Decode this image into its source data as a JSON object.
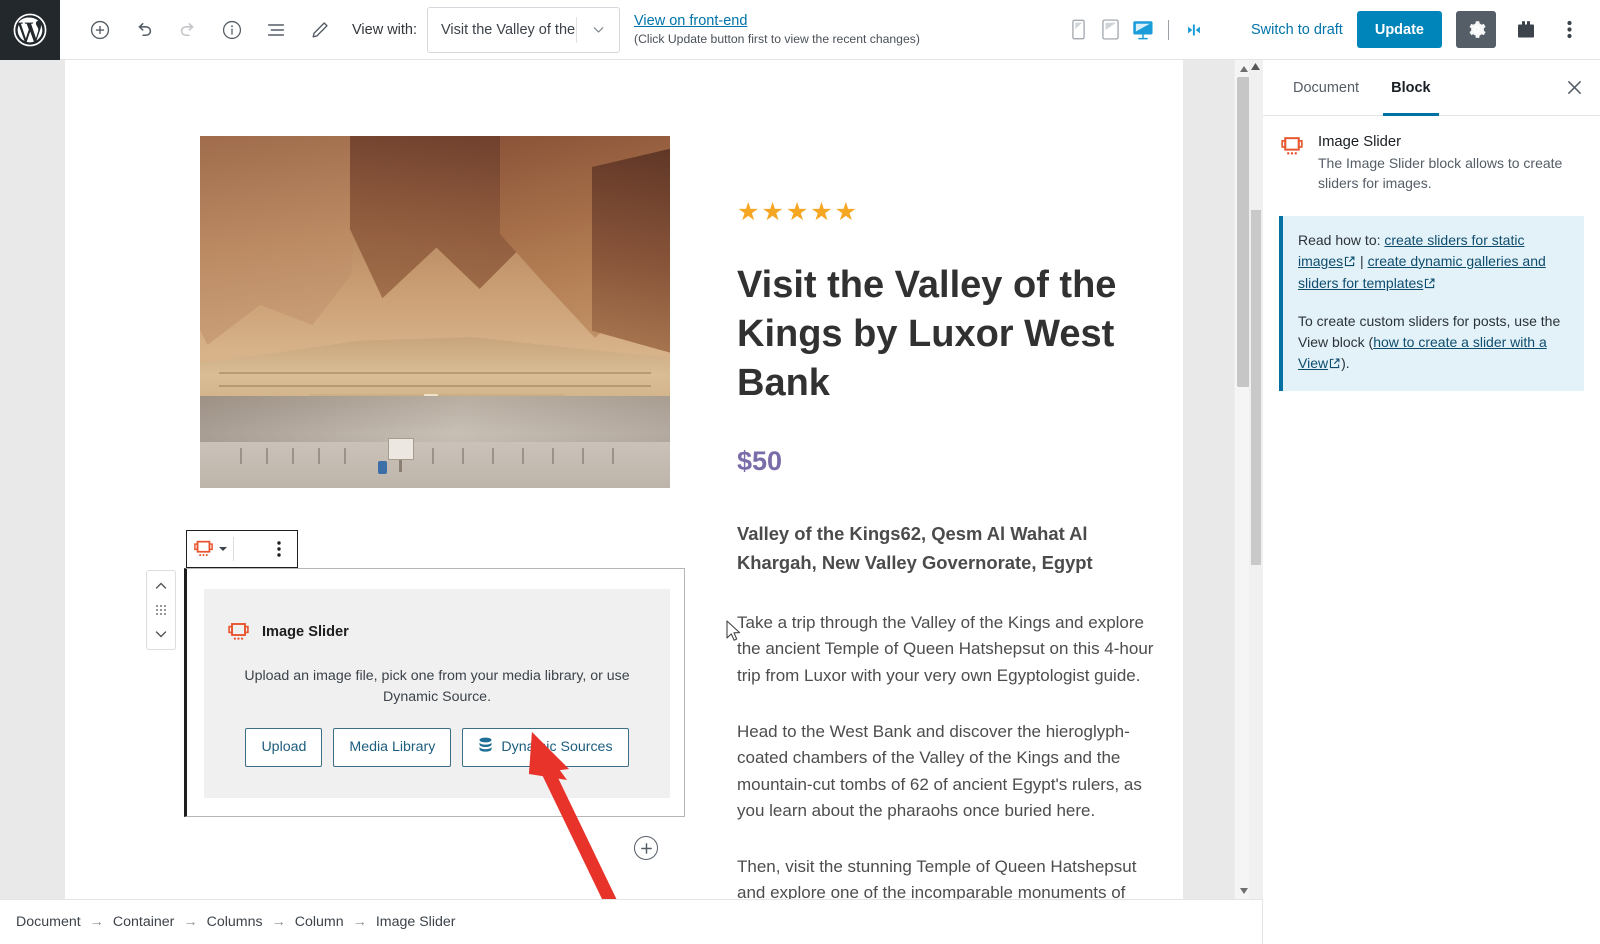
{
  "topbar": {
    "logo_icon": "wordpress-logo-icon",
    "tools": [
      {
        "name": "add-block-button",
        "icon": "plus-circle-icon"
      },
      {
        "name": "undo-button",
        "icon": "undo-arrow-icon"
      },
      {
        "name": "redo-button",
        "icon": "redo-arrow-icon"
      },
      {
        "name": "content-info-button",
        "icon": "info-circle-icon"
      },
      {
        "name": "block-navigation-button",
        "icon": "list-view-icon"
      },
      {
        "name": "edit-mode-button",
        "icon": "pencil-icon"
      }
    ],
    "view_with_label": "View with:",
    "view_with_value": "Visit the Valley of the...",
    "view_with_caret_icon": "chevron-down-icon",
    "frontend_link": "View on front-end",
    "frontend_note": "(Click Update button first to view the recent changes)",
    "devices": [
      {
        "name": "preview-mobile",
        "icon": "mobile-icon",
        "active": false
      },
      {
        "name": "preview-tablet",
        "icon": "tablet-icon",
        "active": false
      },
      {
        "name": "preview-desktop",
        "icon": "desktop-icon",
        "active": true
      },
      {
        "name": "preview-responsive-width",
        "icon": "resize-handles-icon",
        "active": true
      }
    ],
    "switch_to_draft": "Switch to draft",
    "update_label": "Update",
    "settings_icon": "gear-icon",
    "plugin_icon": "toolbox-icon",
    "more_icon": "vertical-dots-icon",
    "accent_blue": "#0085ba",
    "link_blue": "#0073aa"
  },
  "editor": {
    "stars": "★★★★★",
    "star_color": "#f5a623",
    "title": "Visit the Valley of the Kings by Luxor West Bank",
    "price": "$50",
    "price_color": "#7a6ca8",
    "address": "Valley of the Kings62, Qesm Al Wahat Al Khargah, New Valley Governorate, Egypt",
    "paragraphs": [
      "Take a trip through the Valley of the Kings and explore the ancient Temple of Queen Hatshepsut on this 4-hour trip from Luxor with your very own Egyptologist guide.",
      "Head to the West Bank and discover the hieroglyph-coated chambers of the Valley of the Kings and the mountain-cut tombs of 62 of ancient Egypt's rulers, as you learn about the pharaohs once buried here.",
      "Then, visit the stunning Temple of Queen Hatshepsut and explore one of the incomparable monuments of ancient Egypt."
    ],
    "hero_image_alt": "Temple of Queen Hatshepsut at Deir el-Bahari"
  },
  "slider_block": {
    "toolbar": {
      "type_icon": "image-slider-block-icon",
      "type_caret_icon": "chevron-down-icon",
      "more_icon": "vertical-dots-icon"
    },
    "mover": {
      "up_icon": "chevron-up-icon",
      "drag_icon": "drag-handle-icon",
      "down_icon": "chevron-down-icon"
    },
    "icon": "image-slider-block-icon",
    "title": "Image Slider",
    "description": "Upload an image file, pick one from your media library, or use Dynamic Source.",
    "buttons": [
      {
        "name": "upload-button",
        "label": "Upload",
        "icon": null
      },
      {
        "name": "media-library-button",
        "label": "Media Library",
        "icon": null
      },
      {
        "name": "dynamic-sources-button",
        "label": "Dynamic Sources",
        "icon": "database-stack-icon"
      }
    ],
    "accent_orange": "#e8542f",
    "button_border": "#3c6e87"
  },
  "add_block": {
    "icon": "plus-circle-icon"
  },
  "sidebar": {
    "tabs": [
      {
        "name": "tab-document",
        "label": "Document",
        "active": false
      },
      {
        "name": "tab-block",
        "label": "Block",
        "active": true
      }
    ],
    "close_icon": "close-icon",
    "block_icon": "image-slider-block-icon",
    "block_title": "Image Slider",
    "block_description": "The Image Slider block allows to create sliders for images.",
    "notice": {
      "line1_prefix": "Read how to: ",
      "link1": "create sliders for static images",
      "separator": " | ",
      "link2": "create dynamic galleries and sliders for templates",
      "line2_prefix": "To create custom sliders for posts, use the View block (",
      "link3": "how to create a slider with a View",
      "line2_suffix": ").",
      "background": "#e3f2f8",
      "border": "#0071a1"
    }
  },
  "breadcrumb": {
    "separator": "→",
    "items": [
      "Document",
      "Container",
      "Columns",
      "Column",
      "Image Slider"
    ]
  },
  "annotation": {
    "arrow_color": "#e8332a",
    "points_to": "dynamic-sources-button"
  },
  "scrollbar": {
    "up_icon": "caret-up-icon",
    "down_icon": "caret-down-icon"
  }
}
